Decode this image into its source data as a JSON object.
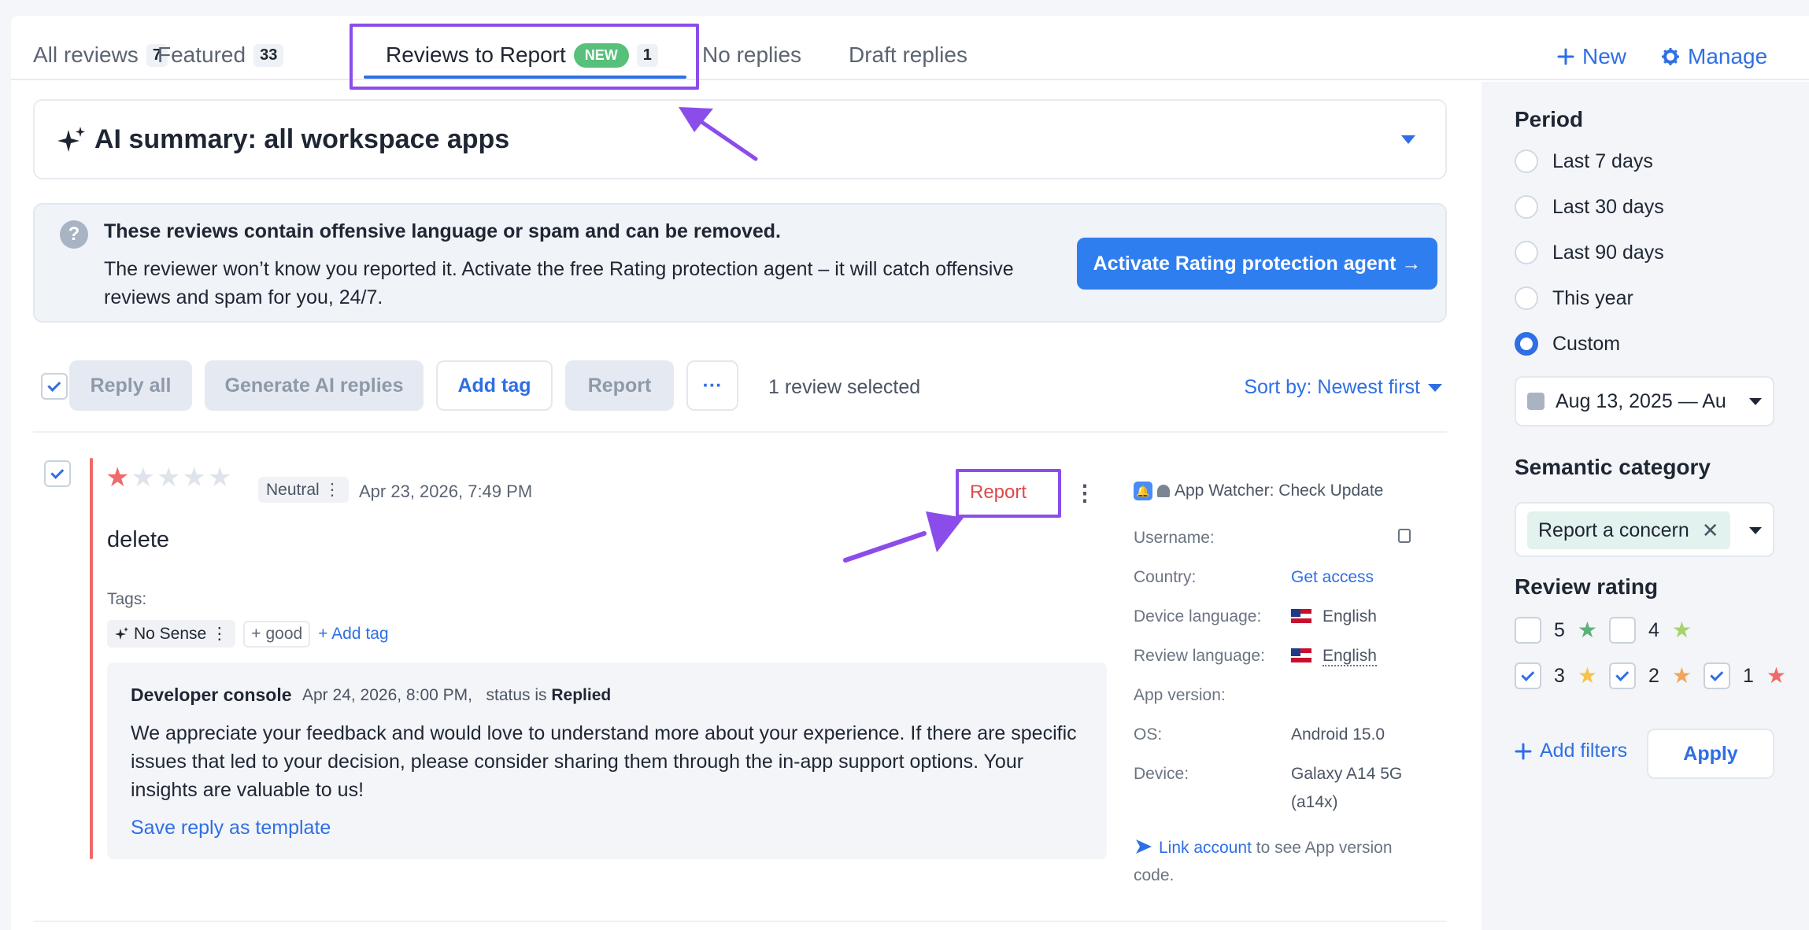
{
  "tabs": [
    {
      "label": "All reviews",
      "count": "7"
    },
    {
      "label": "Featured",
      "count": "33"
    },
    {
      "label": "Reviews to Report",
      "badge": "NEW",
      "count": "1"
    },
    {
      "label": "No replies"
    },
    {
      "label": "Draft replies"
    }
  ],
  "top_actions": {
    "new_label": "New",
    "manage_label": "Manage"
  },
  "ai_summary": {
    "title": "AI summary: all workspace apps"
  },
  "banner": {
    "headline": "These reviews contain offensive language or spam and can be removed.",
    "body": "The reviewer won’t know you reported it. Activate the free Rating protection agent – it will catch offensive reviews and spam for you, 24/7.",
    "cta": "Activate Rating protection agent →"
  },
  "toolbar": {
    "reply_all": "Reply all",
    "generate_ai": "Generate AI replies",
    "add_tag": "Add tag",
    "report": "Report",
    "more": "···",
    "selected_text": "1 review selected",
    "sort": "Sort by: Newest first"
  },
  "review": {
    "rating": 1,
    "sentiment": "Neutral",
    "date": "Apr 23, 2026, 7:49 PM",
    "title": "delete",
    "report_label": "Report",
    "tags_label": "Tags:",
    "tags": [
      "No Sense",
      "good"
    ],
    "add_tag": "Add tag",
    "reply": {
      "source": "Developer console",
      "date": "Apr 24, 2026, 8:00 PM,",
      "status_prefix": "status is",
      "status": "Replied",
      "text": "We appreciate your feedback and would love to understand more about your experience. If there are specific issues that led to your decision, please consider sharing them through the in-app support options. Your insights are valuable to us!",
      "save_template": "Save reply as template"
    },
    "meta": {
      "app_name": "App Watcher: Check Update",
      "username_label": "Username:",
      "country_label": "Country:",
      "country_value": "Get access",
      "device_language_label": "Device language:",
      "device_language_value": "English",
      "review_language_label": "Review language:",
      "review_language_value": "English",
      "app_version_label": "App version:",
      "os_label": "OS:",
      "os_value": "Android 15.0",
      "device_label": "Device:",
      "device_value_1": "Galaxy A14 5G",
      "device_value_2": "(a14x)",
      "link_account": "Link account",
      "link_note": " to see App version code."
    }
  },
  "sidebar": {
    "period_title": "Period",
    "periods": [
      "Last 7 days",
      "Last 30 days",
      "Last 90 days",
      "This year",
      "Custom"
    ],
    "selected_period": "Custom",
    "date_range": "Aug 13, 2025 — Au",
    "semantic_title": "Semantic category",
    "semantic_chip": "Report a concern",
    "rating_title": "Review rating",
    "ratings": [
      {
        "value": "5",
        "checked": false,
        "color": "#5cb37a"
      },
      {
        "value": "4",
        "checked": false,
        "color": "#a5d46b"
      },
      {
        "value": "3",
        "checked": true,
        "color": "#f5c44d"
      },
      {
        "value": "2",
        "checked": true,
        "color": "#f2a65a"
      },
      {
        "value": "1",
        "checked": true,
        "color": "#ee6b6b"
      }
    ],
    "add_filters": "Add filters",
    "apply": "Apply"
  },
  "colors": {
    "accent": "#2f6fe4",
    "highlight": "#8b4dea",
    "danger": "#e04848",
    "star_filled": "#ee6b6b",
    "star_empty": "#dfe4ec"
  }
}
